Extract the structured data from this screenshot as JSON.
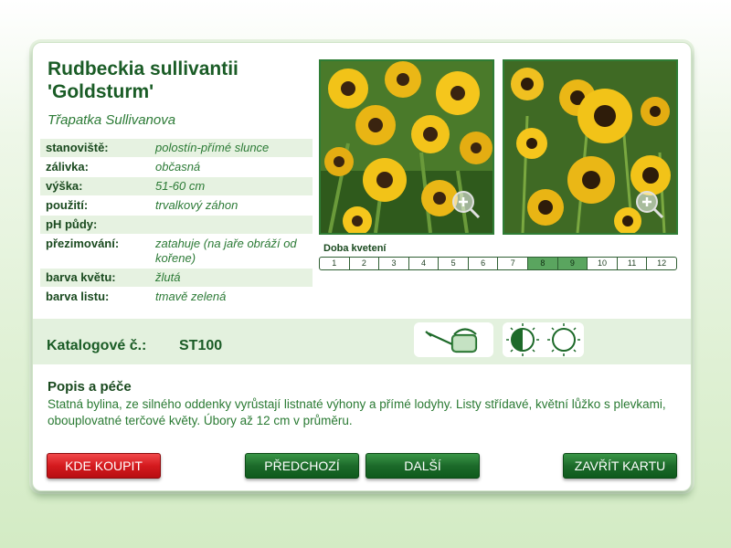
{
  "plant": {
    "name_line1": "Rudbeckia sullivantii",
    "name_line2": "'Goldsturm'",
    "czech_name": "Třapatka Sullivanova"
  },
  "properties": [
    {
      "label": "stanoviště:",
      "value": "polostín-přímé slunce"
    },
    {
      "label": "zálivka:",
      "value": "občasná"
    },
    {
      "label": "výška:",
      "value": "51-60 cm"
    },
    {
      "label": "použití:",
      "value": "trvalkový záhon"
    },
    {
      "label": "pH půdy:",
      "value": ""
    },
    {
      "label": "přezimování:",
      "value": "zatahuje (na jaře obráží od kořene)"
    },
    {
      "label": "barva květu:",
      "value": "žlutá"
    },
    {
      "label": "barva listu:",
      "value": "tmavě zelená"
    }
  ],
  "bloom": {
    "label": "Doba kvetení",
    "months": [
      "1",
      "2",
      "3",
      "4",
      "5",
      "6",
      "7",
      "8",
      "9",
      "10",
      "11",
      "12"
    ],
    "active_months": [
      8,
      9
    ]
  },
  "catalog": {
    "label": "Katalogové č.:",
    "value": "ST100"
  },
  "icons": {
    "watering": "watering-can-icon",
    "sun_partial": "half-sun-icon",
    "sun_full": "full-sun-icon",
    "zoom": "zoom-plus-icon"
  },
  "description": {
    "title": "Popis a péče",
    "text": "Statná bylina, ze silného oddenky vyrůstají listnaté výhony a přímé lodyhy. Listy střídavé, květní lůžko s plevkami, obouplovatné terčové květy. Úbory až 12 cm v průměru."
  },
  "buttons": {
    "buy": "KDE KOUPIT",
    "prev": "PŘEDCHOZÍ",
    "next": "DALŠÍ",
    "close": "ZAVŘÍT KARTU"
  },
  "colors": {
    "accent_green": "#1a5c26",
    "button_green": "#1c6a2a",
    "button_red": "#d41a1e",
    "bloom_active": "#5aa55f"
  }
}
